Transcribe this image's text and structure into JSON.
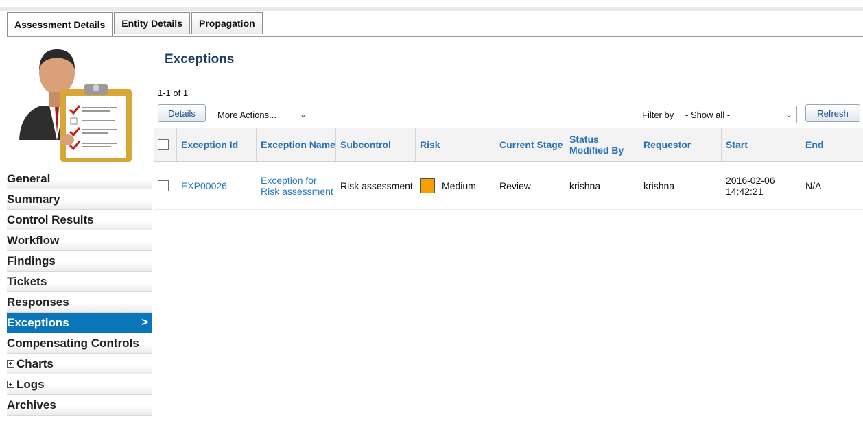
{
  "tabs": [
    {
      "label": "Assessment Details",
      "active": true
    },
    {
      "label": "Entity Details",
      "active": false
    },
    {
      "label": "Propagation",
      "active": false
    }
  ],
  "sidebar": {
    "items": [
      {
        "label": "General"
      },
      {
        "label": "Summary"
      },
      {
        "label": "Control Results"
      },
      {
        "label": "Workflow"
      },
      {
        "label": "Findings"
      },
      {
        "label": "Tickets"
      },
      {
        "label": "Responses"
      },
      {
        "label": "Exceptions",
        "active": true
      },
      {
        "label": "Compensating Controls"
      },
      {
        "label": "Charts",
        "expandable": true
      },
      {
        "label": "Logs",
        "expandable": true
      },
      {
        "label": "Archives"
      }
    ],
    "active_chevron": ">"
  },
  "main": {
    "title": "Exceptions",
    "count": "1-1 of 1",
    "details_button": "Details",
    "more_actions": "More Actions...",
    "filter_label": "Filter by",
    "filter_value": "- Show all -",
    "refresh_button": "Refresh",
    "dropdown_glyph": "⌄"
  },
  "table": {
    "columns": [
      "Exception Id",
      "Exception Name",
      "Subcontrol",
      "Risk",
      "Current Stage",
      "Status Modified By",
      "Requestor",
      "Start",
      "End"
    ],
    "rows": [
      {
        "exception_id": "EXP00026",
        "exception_name": "Exception for Risk assessment",
        "subcontrol": "Risk assessment",
        "risk": "Medium",
        "current_stage": "Review",
        "status_modified_by": "krishna",
        "requestor": "krishna",
        "start": "2016-02-06 14:42:21",
        "end": "N/A"
      }
    ]
  },
  "colors": {
    "active_nav": "#0a76b8",
    "heading": "#1b3e5e",
    "link": "#2a7ac0",
    "risk_medium": "#f6a000"
  }
}
